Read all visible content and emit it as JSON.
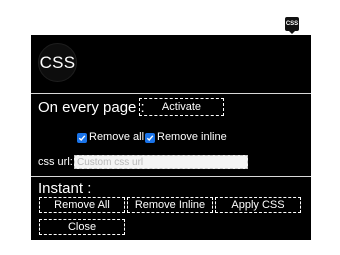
{
  "toolbar": {
    "extension_icon_label": "CSS"
  },
  "popup": {
    "logo_text": "CSS",
    "on_every_page": {
      "label": "On every page :",
      "activate_button": "Activate",
      "remove_all": {
        "label": "Remove all",
        "checked": true
      },
      "remove_inline": {
        "label": "Remove inline",
        "checked": true
      }
    },
    "css_url": {
      "label": "css url:",
      "placeholder": "Custom css url",
      "value": ""
    },
    "instant": {
      "label": "Instant :",
      "remove_all_button": "Remove All",
      "remove_inline_button": "Remove Inline",
      "apply_css_button": "Apply CSS",
      "close_button": "Close"
    }
  },
  "colors": {
    "popup_background": "#000000",
    "checkbox_accent": "#1a73e8",
    "text": "#ffffff"
  }
}
